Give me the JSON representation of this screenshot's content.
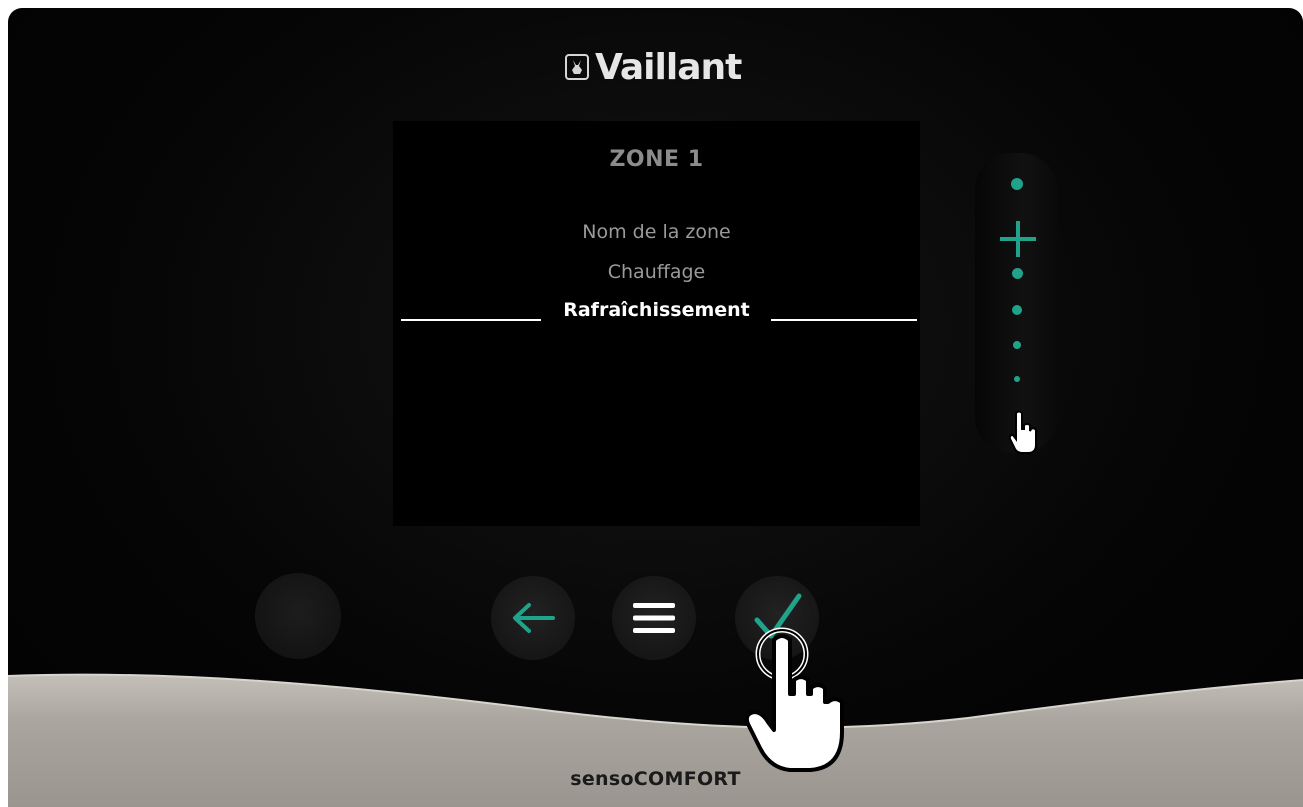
{
  "brand": {
    "logo_text": "Vaillant",
    "emblem_icon": "vaillant-hare-emblem",
    "product_name": "sensoCOMFORT"
  },
  "screen": {
    "title": "ZONE 1",
    "menu_items": [
      {
        "label": "Nom de la zone",
        "selected": false
      },
      {
        "label": "Chauffage",
        "selected": false
      },
      {
        "label": "Rafraîchissement",
        "selected": true
      }
    ]
  },
  "side_control": {
    "plus_icon": "plus-icon",
    "accent_color": "#1fa38a"
  },
  "buttons": {
    "back_icon": "arrow-left-icon",
    "menu_icon": "hamburger-menu-icon",
    "ok_icon": "checkmark-icon"
  },
  "colors": {
    "accent": "#1fa38a",
    "screen_bg": "#000000",
    "text_dim": "#9a9a9a",
    "text_selected": "#ffffff",
    "bezel_base": "#a9a49d"
  },
  "cursors": {
    "scroll_pointer": "hand-pointer-icon",
    "tap_pointer": "hand-tap-icon"
  }
}
